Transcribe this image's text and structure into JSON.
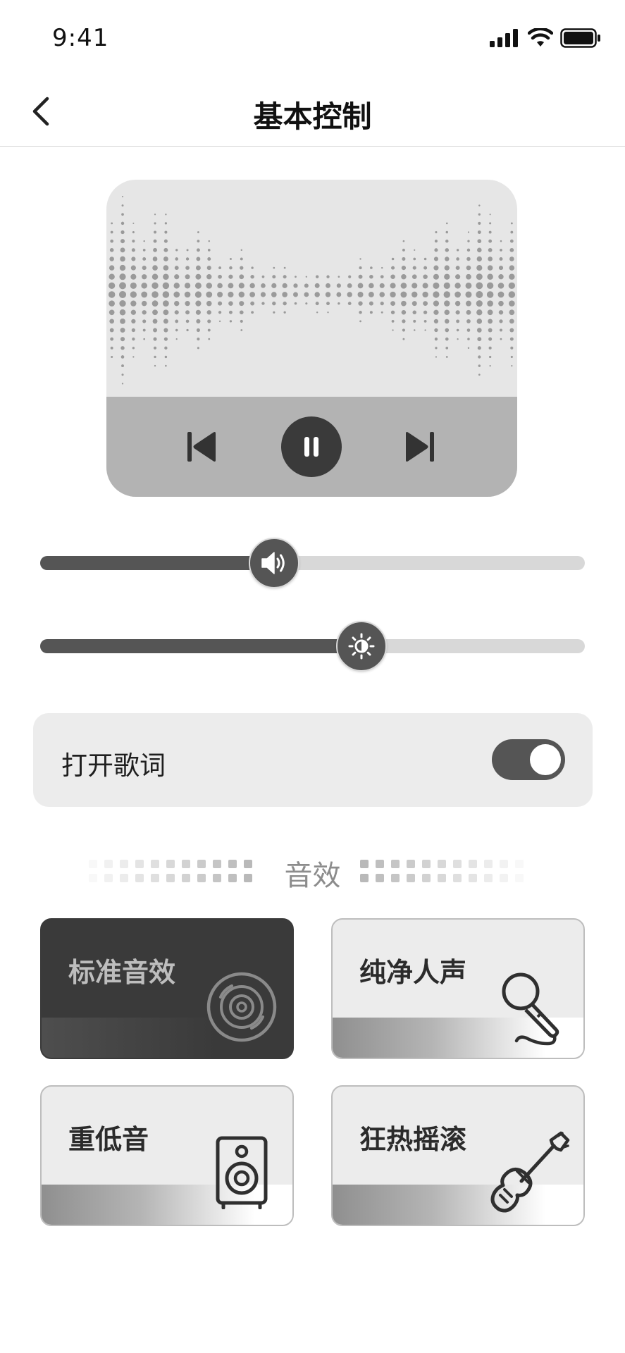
{
  "status_bar": {
    "time": "9:41"
  },
  "nav": {
    "title": "基本控制"
  },
  "player": {
    "state": "playing",
    "volume_level": 0.43,
    "brightness_level": 0.59
  },
  "lyrics": {
    "label": "打开歌词",
    "enabled": true
  },
  "sound_effects": {
    "section_title": "音效",
    "items": [
      {
        "label": "标准音效",
        "icon": "vinyl-disc-icon",
        "selected": true
      },
      {
        "label": "纯净人声",
        "icon": "microphone-icon",
        "selected": false
      },
      {
        "label": "重低音",
        "icon": "speaker-icon",
        "selected": false
      },
      {
        "label": "狂热摇滚",
        "icon": "guitar-icon",
        "selected": false
      }
    ]
  },
  "colors": {
    "accent_dark": "#555555",
    "card_active": "#3a3a3a",
    "card_light": "#ececec",
    "muted_text": "#8c8c8c"
  }
}
